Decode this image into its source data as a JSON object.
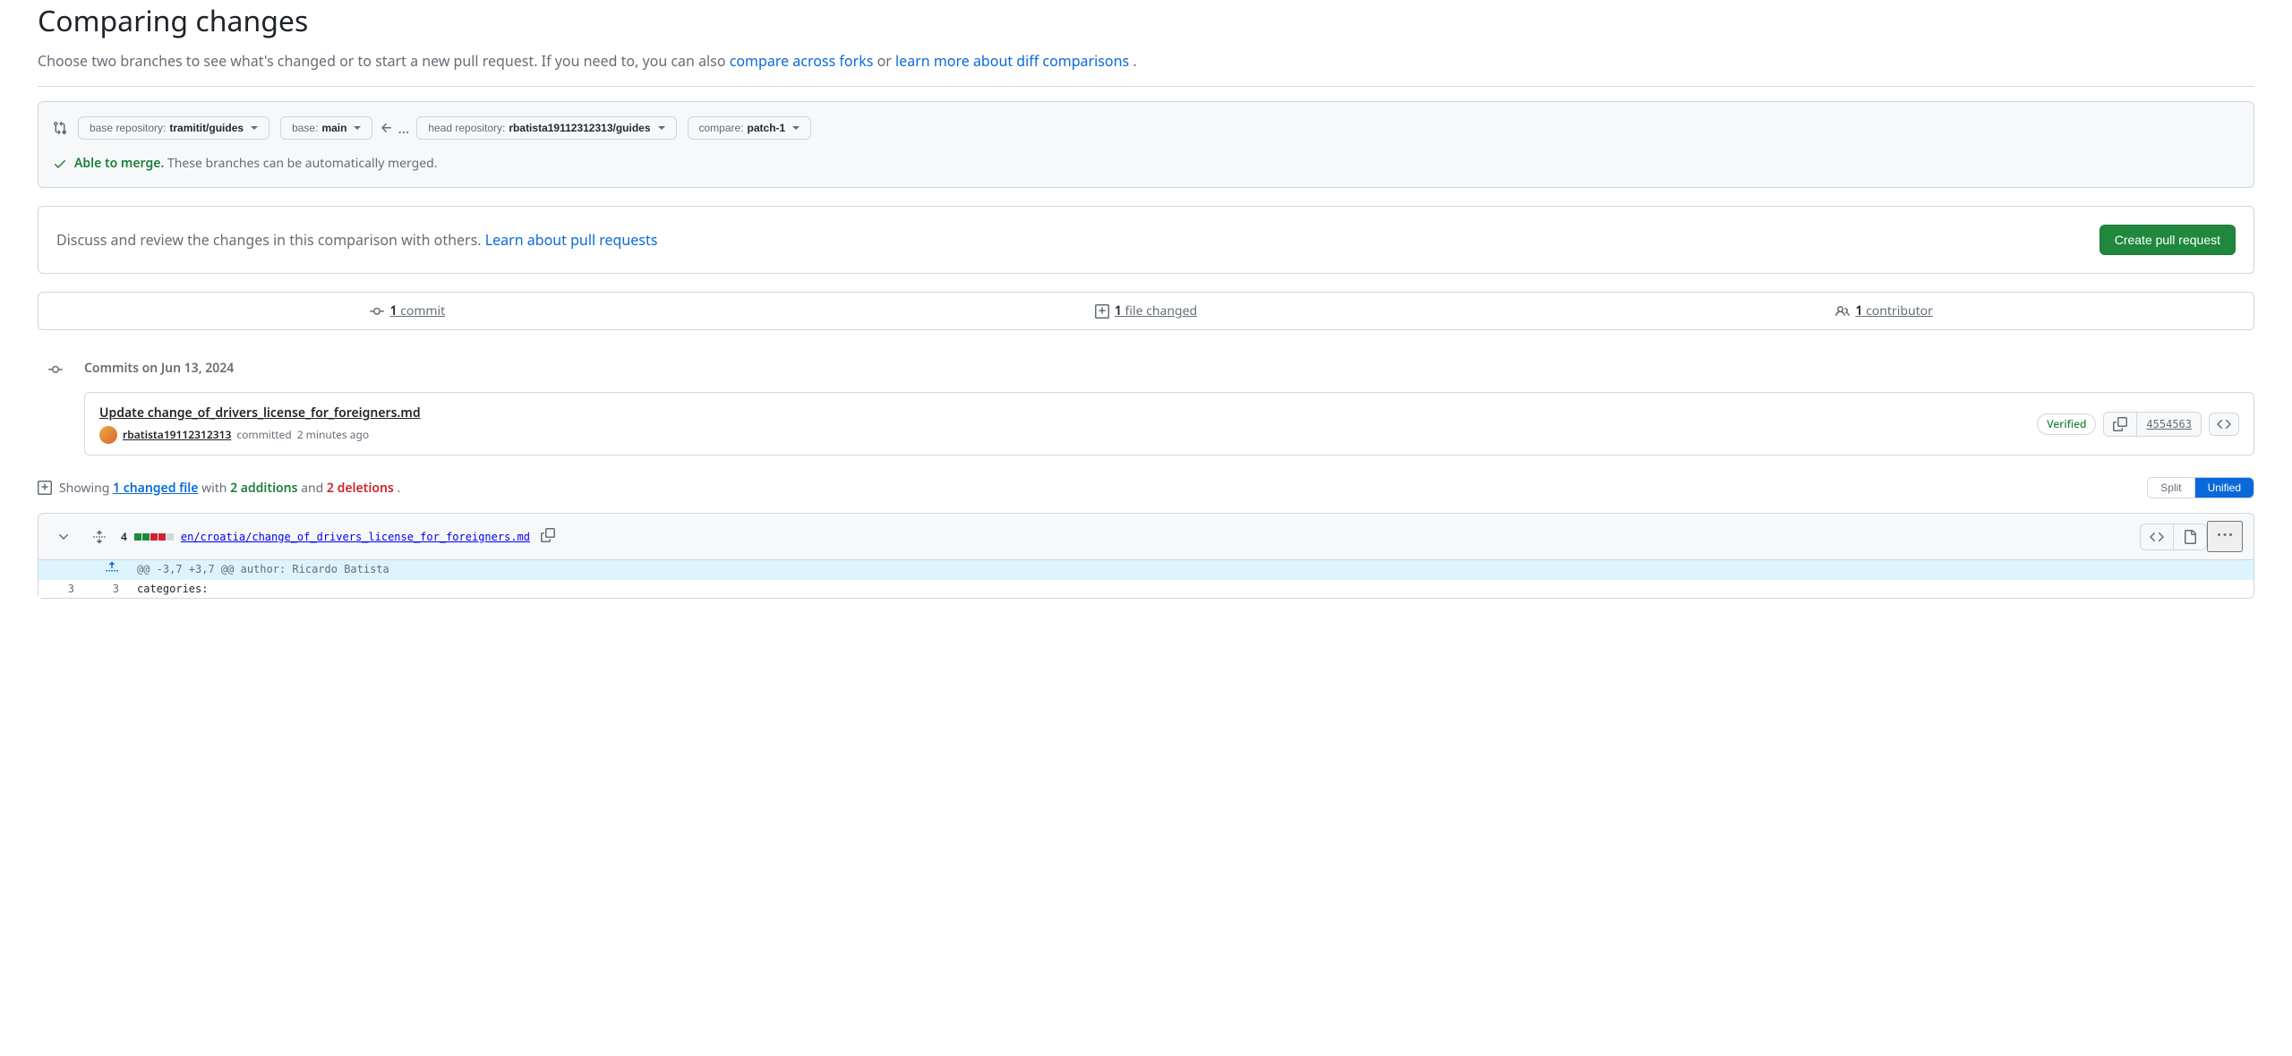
{
  "page": {
    "title": "Comparing changes",
    "subtitle_part1": "Choose two branches to see what's changed or to start a new pull request. If you need to, you can also ",
    "subtitle_link1": "compare across forks",
    "subtitle_part2": " or ",
    "subtitle_link2": "learn more about diff comparisons",
    "subtitle_part3": "."
  },
  "compare": {
    "base_repo_label": "base repository: ",
    "base_repo_value": "tramitit/guides",
    "base_branch_label": "base: ",
    "base_branch_value": "main",
    "head_repo_label": "head repository: ",
    "head_repo_value": "rbatista19112312313/guides",
    "compare_label": "compare: ",
    "compare_value": "patch-1",
    "ellipsis": "..."
  },
  "merge_status": {
    "able_text": "Able to merge.",
    "detail": " These branches can be automatically merged."
  },
  "create_pr": {
    "text_part1": "Discuss and review the changes in this comparison with others. ",
    "link": "Learn about pull requests",
    "button": "Create pull request"
  },
  "stats": {
    "commits_count": "1",
    "commits_label": " commit",
    "files_count": "1",
    "files_label": " file changed",
    "contributors_count": "1",
    "contributors_label": " contributor"
  },
  "timeline": {
    "date": "Commits on Jun 13, 2024"
  },
  "commit": {
    "title": "Update change_of_drivers_license_for_foreigners.md",
    "author": "rbatista19112312313",
    "committed_text": " committed ",
    "time": "2 minutes ago",
    "verified": "Verified",
    "sha": "4554563"
  },
  "diff_summary": {
    "showing": "Showing ",
    "changed_file": "1 changed file",
    "with_text": " with ",
    "additions": "2 additions",
    "and_text": " and ",
    "deletions": "2 deletions",
    "period": "."
  },
  "view_toggle": {
    "split": "Split",
    "unified": "Unified"
  },
  "file": {
    "change_count": "4",
    "path": "en/croatia/change_of_drivers_license_for_foreigners.md"
  },
  "diff": {
    "hunk": "@@ -3,7 +3,7 @@ author: Ricardo Batista",
    "line_num_old_1": "3",
    "line_num_new_1": "3",
    "line_content_1": "categories:"
  }
}
